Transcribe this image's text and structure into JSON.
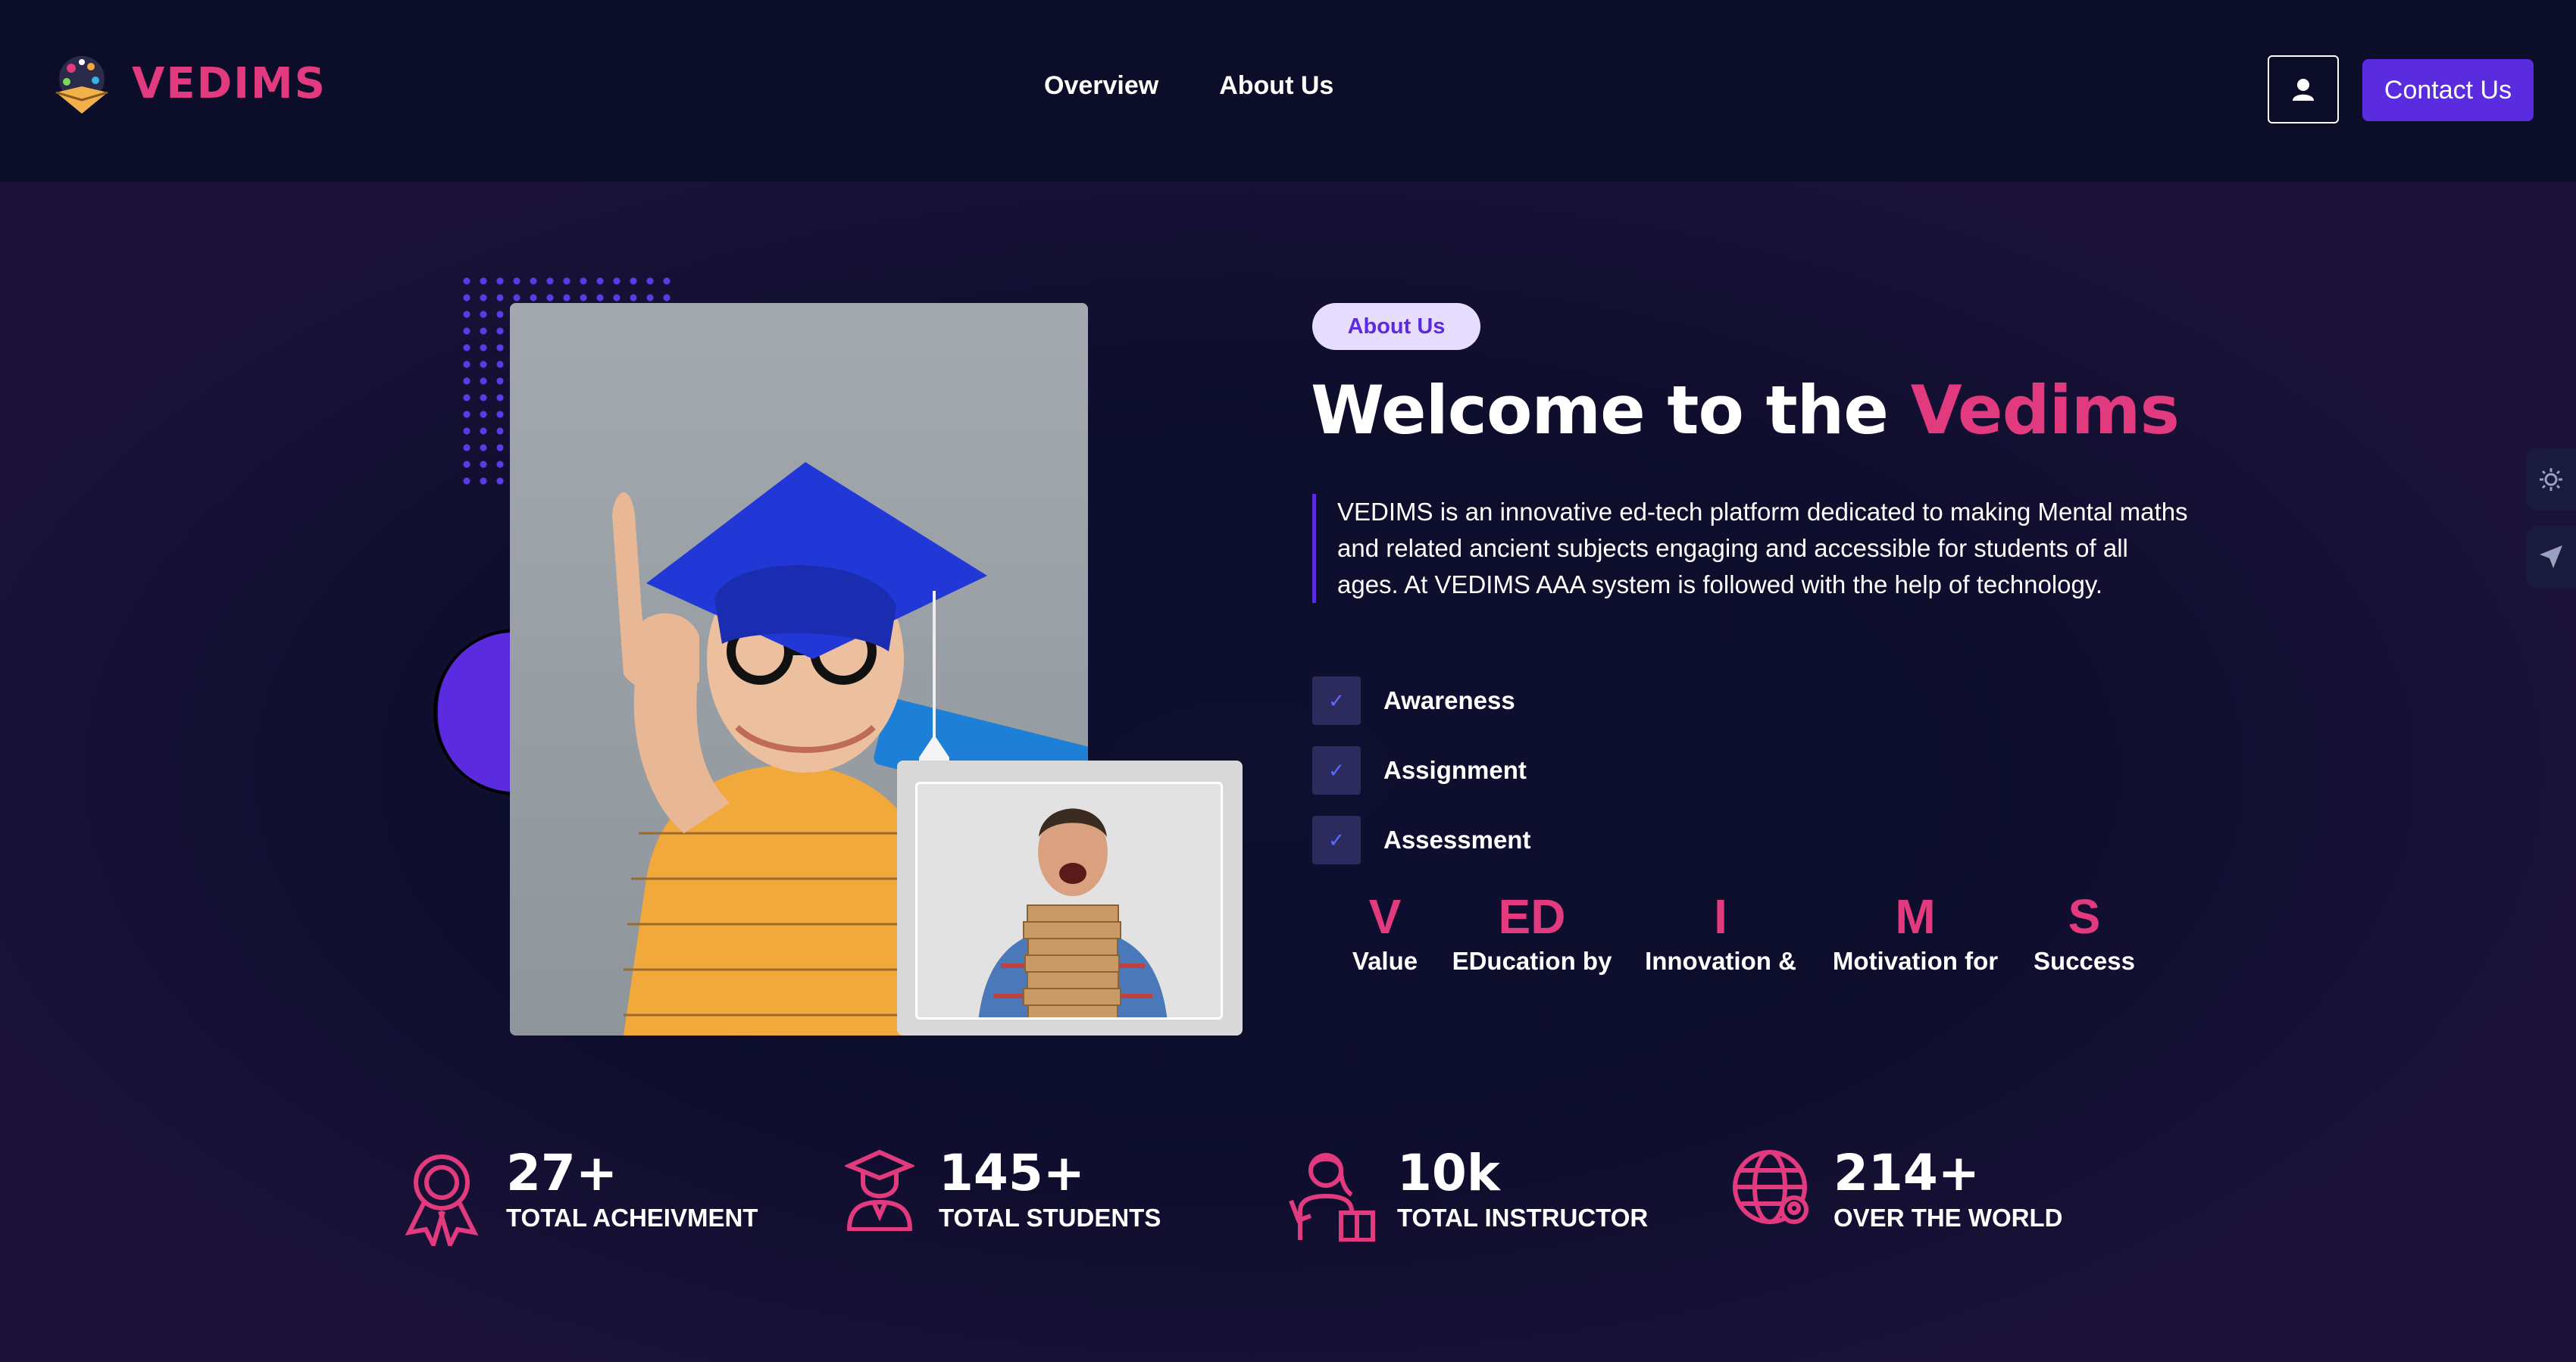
{
  "brand": {
    "name": "VEDIMS",
    "accent_color": "#e23a7e",
    "primary_color": "#5b2be0"
  },
  "nav": {
    "items": [
      "Overview",
      "About Us"
    ]
  },
  "header": {
    "user_icon": "user-icon",
    "contact_label": "Contact Us"
  },
  "about": {
    "pill": "About Us",
    "title_prefix": "Welcome to the ",
    "title_accent": "Vedims",
    "description": "VEDIMS is an innovative ed-tech platform dedicated to making Mental maths and related ancient subjects engaging and accessible for students of all ages. At VEDIMS AAA system is followed with the help of technology.",
    "checks": [
      "Awareness",
      "Assignment",
      "Assessment"
    ],
    "acronym": [
      {
        "letter": "V",
        "word": "Value"
      },
      {
        "letter": "ED",
        "word": "EDucation by"
      },
      {
        "letter": "I",
        "word": "Innovation &"
      },
      {
        "letter": "M",
        "word": "Motivation for"
      },
      {
        "letter": "S",
        "word": "Success"
      }
    ]
  },
  "stats": [
    {
      "icon": "award-icon",
      "value": "27+",
      "label": "TOTAL ACHEIVMENT"
    },
    {
      "icon": "student-icon",
      "value": "145+",
      "label": "TOTAL STUDENTS"
    },
    {
      "icon": "instructor-icon",
      "value": "10k",
      "label": "TOTAL INSTRUCTOR"
    },
    {
      "icon": "globe-icon",
      "value": "214+",
      "label": "OVER THE WORLD"
    }
  ],
  "side_tabs": [
    "sun-icon",
    "send-icon"
  ]
}
